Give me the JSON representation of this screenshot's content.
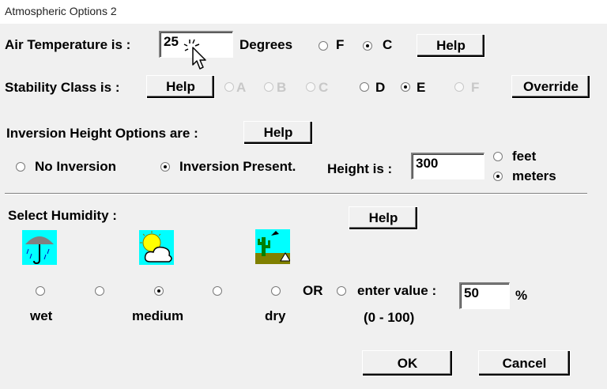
{
  "window": {
    "title": "Atmospheric Options 2"
  },
  "air_temperature": {
    "label": "Air Temperature is :",
    "value": "25",
    "unit_label": "Degrees",
    "units": [
      {
        "label": "F",
        "selected": false
      },
      {
        "label": "C",
        "selected": true
      }
    ],
    "help_label": "Help"
  },
  "stability": {
    "label": "Stability Class is :",
    "help_label": "Help",
    "classes": [
      {
        "label": "A",
        "enabled": false,
        "selected": false
      },
      {
        "label": "B",
        "enabled": false,
        "selected": false
      },
      {
        "label": "C",
        "enabled": false,
        "selected": false
      },
      {
        "label": "D",
        "enabled": true,
        "selected": false
      },
      {
        "label": "E",
        "enabled": true,
        "selected": true
      },
      {
        "label": "F",
        "enabled": false,
        "selected": false
      }
    ],
    "override_label": "Override"
  },
  "inversion": {
    "label": "Inversion Height Options are :",
    "help_label": "Help",
    "no_inversion_label": "No Inversion",
    "present_label": "Inversion Present.",
    "selected": "present",
    "height_label": "Height is :",
    "height_value": "300",
    "units": [
      {
        "label": "feet",
        "selected": false
      },
      {
        "label": "meters",
        "selected": true
      }
    ]
  },
  "humidity": {
    "label": "Select Humidity :",
    "help_label": "Help",
    "wet_label": "wet",
    "medium_label": "medium",
    "dry_label": "dry",
    "or_label": "OR",
    "enter_value_label": "enter value :",
    "range_label": "(0 - 100)",
    "value": "50",
    "percent_label": "%",
    "selected": "medium",
    "icons": [
      "umbrella-rain-icon",
      "sun-cloud-icon",
      "desert-cactus-icon"
    ]
  },
  "buttons": {
    "ok_label": "OK",
    "cancel_label": "Cancel"
  },
  "colors": {
    "dialog_bg": "#f0f0f0",
    "icon_sky": "#00ffff",
    "icon_sun": "#ffff00",
    "icon_ground": "#808000"
  }
}
